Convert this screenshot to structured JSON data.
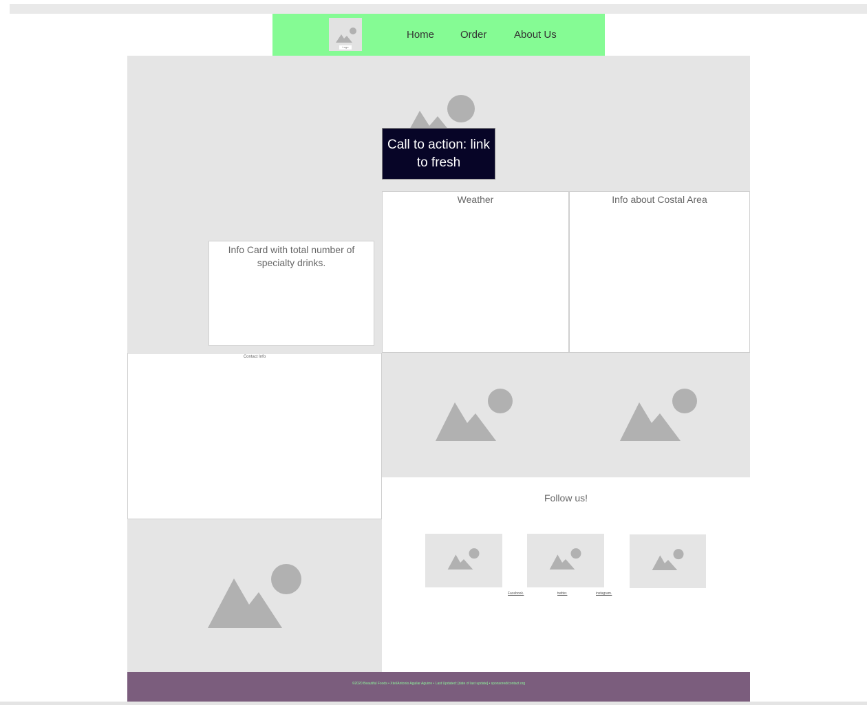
{
  "nav": {
    "logo_label": "Logo",
    "items": [
      {
        "label": "Home"
      },
      {
        "label": "Order"
      },
      {
        "label": "About Us"
      }
    ]
  },
  "hero": {
    "cta_label": "Call to action: link to fresh"
  },
  "cards": {
    "info_drinks": "Info Card with total number of specialty drinks.",
    "weather": "Weather",
    "coastal": "Info about Costal Area",
    "contact": "Contact Info"
  },
  "social": {
    "heading": "Follow us!",
    "links": [
      {
        "label": "Facebook."
      },
      {
        "label": "twitter."
      },
      {
        "label": "instagram."
      }
    ]
  },
  "footer": {
    "text": "©2020 Beautiful Foods • Xtel/Antonio Aguilar Aguirre • Last Updated: [date of last update] • sponsored/contact.org"
  },
  "colors": {
    "nav_bg": "#85fb94",
    "cta_bg": "#070527",
    "footer_bg": "#7b5d7d",
    "placeholder_bg": "#e5e5e5",
    "placeholder_icon": "#b1b1b1"
  }
}
